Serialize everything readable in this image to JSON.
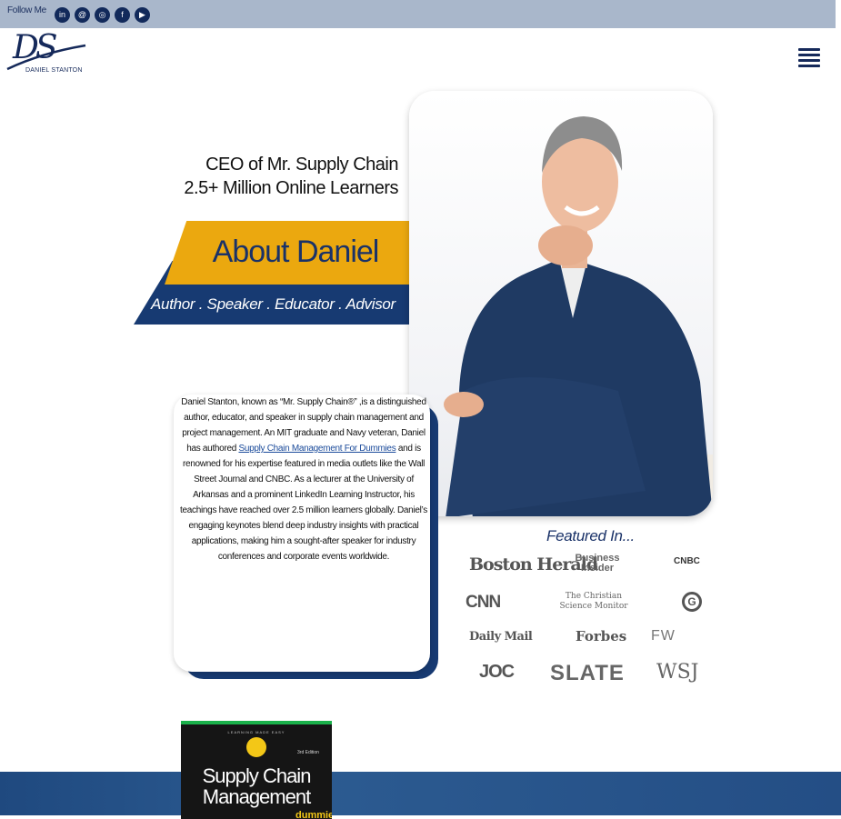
{
  "topbar": {
    "follow_label": "Follow Me",
    "social": [
      {
        "name": "linkedin-icon",
        "glyph": "in"
      },
      {
        "name": "threads-icon",
        "glyph": "@"
      },
      {
        "name": "instagram-icon",
        "glyph": "◎"
      },
      {
        "name": "facebook-icon",
        "glyph": "f"
      },
      {
        "name": "youtube-icon",
        "glyph": "▶"
      }
    ]
  },
  "logo": {
    "monogram": "DS",
    "name": "DANIEL STANTON"
  },
  "hero": {
    "line1": "CEO of Mr. Supply Chain",
    "line2": "2.5+ Million Online Learners",
    "title": "About Daniel",
    "tagline": "Author . Speaker . Educator . Advisor"
  },
  "bio": {
    "intro": "Daniel Stanton, known as “Mr. Supply Chain®” ,is a distinguished author, educator, and speaker in supply chain management and project management. An MIT graduate and Navy veteran, Daniel has authored ",
    "link": "Supply Chain Management For Dummies",
    "rest": " and is renowned for his expertise featured in media outlets like the Wall Street Journal and CNBC. As a lecturer at the University of Arkansas and a prominent LinkedIn Learning Instructor, his teachings have reached over 2.5 million learners globally. Daniel’s engaging keynotes blend deep industry insights with practical applications, making him a sought-after speaker for industry conferences and corporate events worldwide."
  },
  "featured": {
    "title": "Featured In...",
    "logos": [
      "Boston Herald",
      "Business Insider",
      "CNBC",
      "CNN",
      "The Christian Science Monitor",
      "G",
      "Daily Mail",
      "Forbes",
      "FW",
      "JOC",
      "SLATE",
      "WSJ"
    ]
  },
  "book": {
    "series_tag": "LEARNING MADE EASY",
    "edition": "3rd Edition",
    "title": "Supply Chain Management",
    "brand": "dummies"
  },
  "colors": {
    "navy": "#173a72",
    "gold": "#eba80f",
    "topbar": "#a9b7cb"
  }
}
